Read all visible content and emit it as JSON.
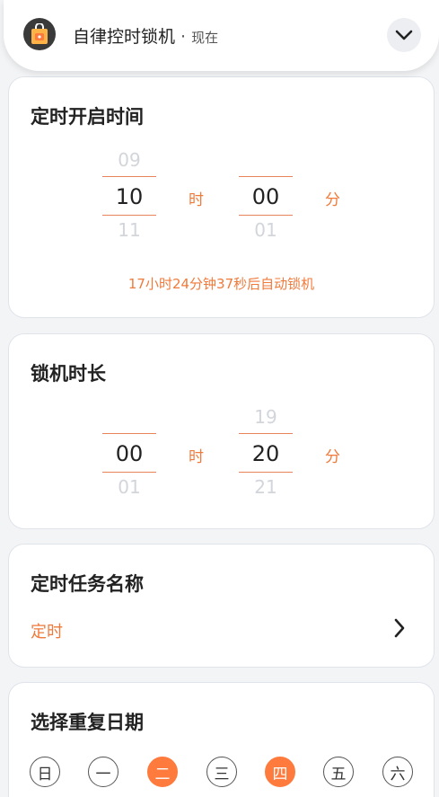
{
  "notification": {
    "app_name": "自律控时锁机",
    "separator": "·",
    "time": "现在",
    "expand_icon": "chevron-down-icon",
    "app_icon": "lock-bag-icon"
  },
  "start_time": {
    "title": "定时开启时间",
    "hour": {
      "prev": "09",
      "value": "10",
      "next": "11",
      "unit": "时"
    },
    "minute": {
      "prev": "",
      "value": "00",
      "next": "01",
      "unit": "分"
    },
    "countdown": "17小时24分钟37秒后自动锁机"
  },
  "duration": {
    "title": "锁机时长",
    "hour": {
      "prev": "",
      "value": "00",
      "next": "01",
      "unit": "时"
    },
    "minute": {
      "prev": "19",
      "value": "20",
      "next": "21",
      "unit": "分"
    }
  },
  "task_name": {
    "title": "定时任务名称",
    "value": "定时",
    "chevron_icon": "chevron-right-icon"
  },
  "repeat": {
    "title": "选择重复日期",
    "days": [
      {
        "label": "日",
        "selected": false
      },
      {
        "label": "一",
        "selected": false
      },
      {
        "label": "二",
        "selected": true
      },
      {
        "label": "三",
        "selected": false
      },
      {
        "label": "四",
        "selected": true
      },
      {
        "label": "五",
        "selected": false
      },
      {
        "label": "六",
        "selected": false
      }
    ]
  },
  "colors": {
    "accent": "#ff7a3d",
    "accent_text": "#ef7a3c",
    "faded_digit": "#d2d5da"
  }
}
